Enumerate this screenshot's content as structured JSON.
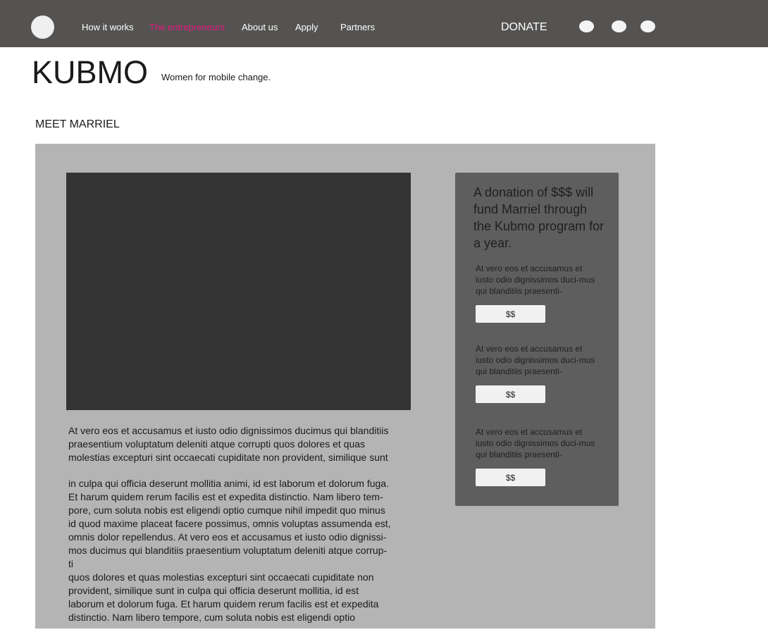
{
  "nav": {
    "items": [
      {
        "label": "How it works",
        "active": false
      },
      {
        "label": "The entrepreneurs",
        "active": true
      },
      {
        "label": "About us",
        "active": false
      },
      {
        "label": "Apply",
        "active": false
      },
      {
        "label": "Partners",
        "active": false
      }
    ],
    "donate_label": "DONATE",
    "social_icons": [
      "social-icon-1",
      "social-icon-2",
      "social-icon-3"
    ]
  },
  "colors": {
    "header_bg": "#545352",
    "accent": "#e8197c",
    "panel_bg": "#b4b4b4",
    "donation_box_bg": "#5e5e5e",
    "video_bg": "#333333"
  },
  "brand": {
    "name": "KUBMO",
    "tagline": "Women for mobile change."
  },
  "section": {
    "title": "MEET MARRIEL"
  },
  "story": {
    "paragraphs": [
      "At vero eos et accusamus et iusto odio dignissimos ducimus qui blanditiis\npraesentium voluptatum deleniti atque corrupti quos dolores et quas\nmolestias excepturi sint occaecati cupiditate non provident, similique sunt",
      "in culpa qui officia deserunt mollitia animi, id est laborum et dolorum fuga.\nEt harum quidem rerum facilis est et expedita distinctio. Nam libero tem-\npore, cum soluta nobis est eligendi optio cumque nihil impedit quo minus\nid quod maxime placeat facere possimus, omnis voluptas assumenda est,\nomnis dolor repellendus. At vero eos et accusamus et iusto odio dignissi-\nmos ducimus qui blanditiis praesentium voluptatum deleniti atque corrup-\nti\nquos dolores et quas molestias excepturi sint occaecati cupiditate non\nprovident, similique sunt in culpa qui officia deserunt mollitia, id est\nlaborum et dolorum fuga. Et harum quidem rerum facilis est et expedita\ndistinctio. Nam libero tempore, cum soluta nobis est eligendi optio"
    ]
  },
  "donation": {
    "heading": "A donation of $$$ will fund Marriel through the Kubmo program for a year.",
    "tiers": [
      {
        "text": "At vero eos et accusamus et iusto odio dignissimos duci-mus qui blanditiis praesenti-",
        "button": "$$"
      },
      {
        "text": "At vero eos et accusamus et iusto odio dignissimos duci-mus qui blanditiis praesenti-",
        "button": "$$"
      },
      {
        "text": "At vero eos et accusamus et iusto odio dignissimos duci-mus qui blanditiis praesenti-",
        "button": "$$"
      }
    ]
  }
}
